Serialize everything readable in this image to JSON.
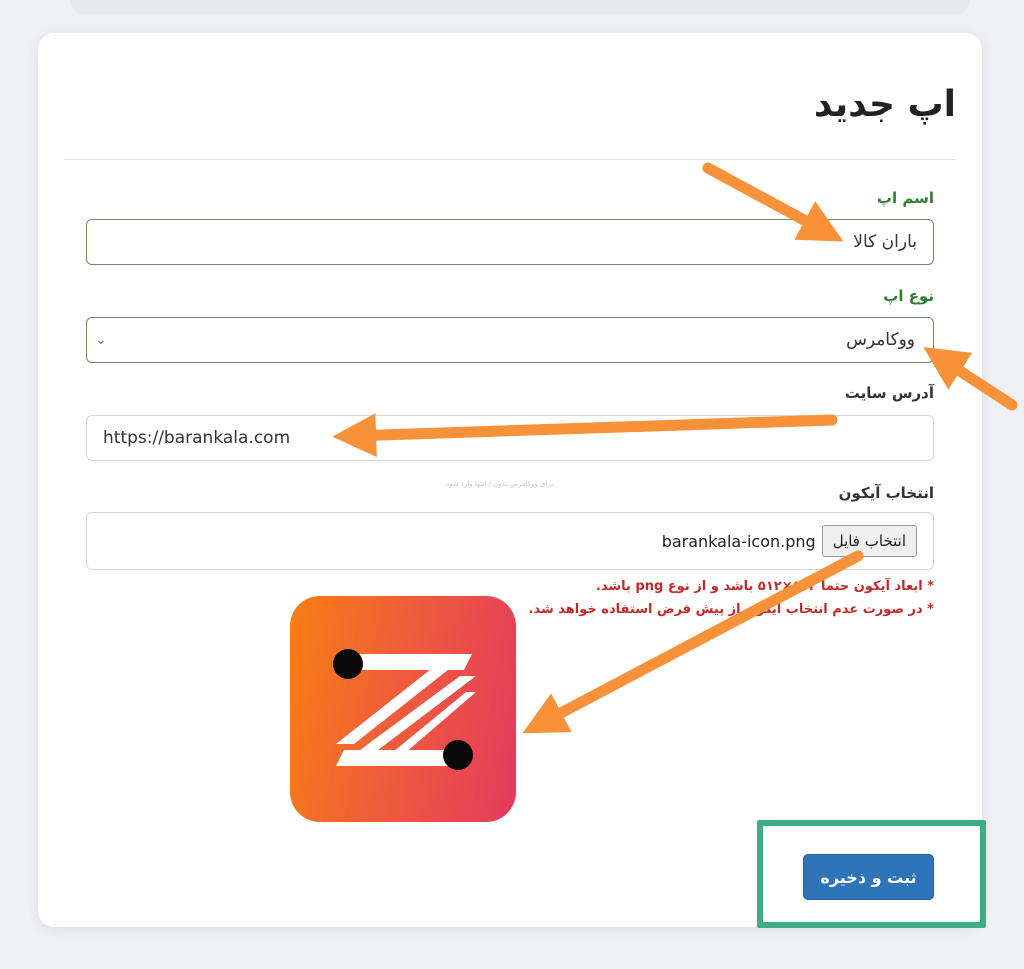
{
  "page": {
    "title": "اپ جدید"
  },
  "form": {
    "app_name": {
      "label": "اسم اپ",
      "value": "باران کالا"
    },
    "app_type": {
      "label": "نوع اپ",
      "selected": "ووکامرس"
    },
    "site_url": {
      "label": "آدرس سایت",
      "value": "https://barankala.com",
      "hint": "برای ووکامرس بدون / انتها وارد شود"
    },
    "icon": {
      "label": "انتخاب آیکون",
      "button_label": "انتخاب فایل",
      "file_name": "barankala-icon.png",
      "note_1": "* ابعاد آیکون حتما ۵۱۲×۵۱۲ باشد و از نوع png باشد.",
      "note_2": "* در صورت عدم انتخاب آیکون از پیش فرض استفاده خواهد شد."
    },
    "save_label": "ثبت و ذخیره"
  },
  "colors": {
    "label_green": "#2e7d32",
    "note_red": "#c62828",
    "save_blue": "#2f73b8",
    "annotation_orange": "#f7923a",
    "highlight_green": "#3fac86"
  }
}
